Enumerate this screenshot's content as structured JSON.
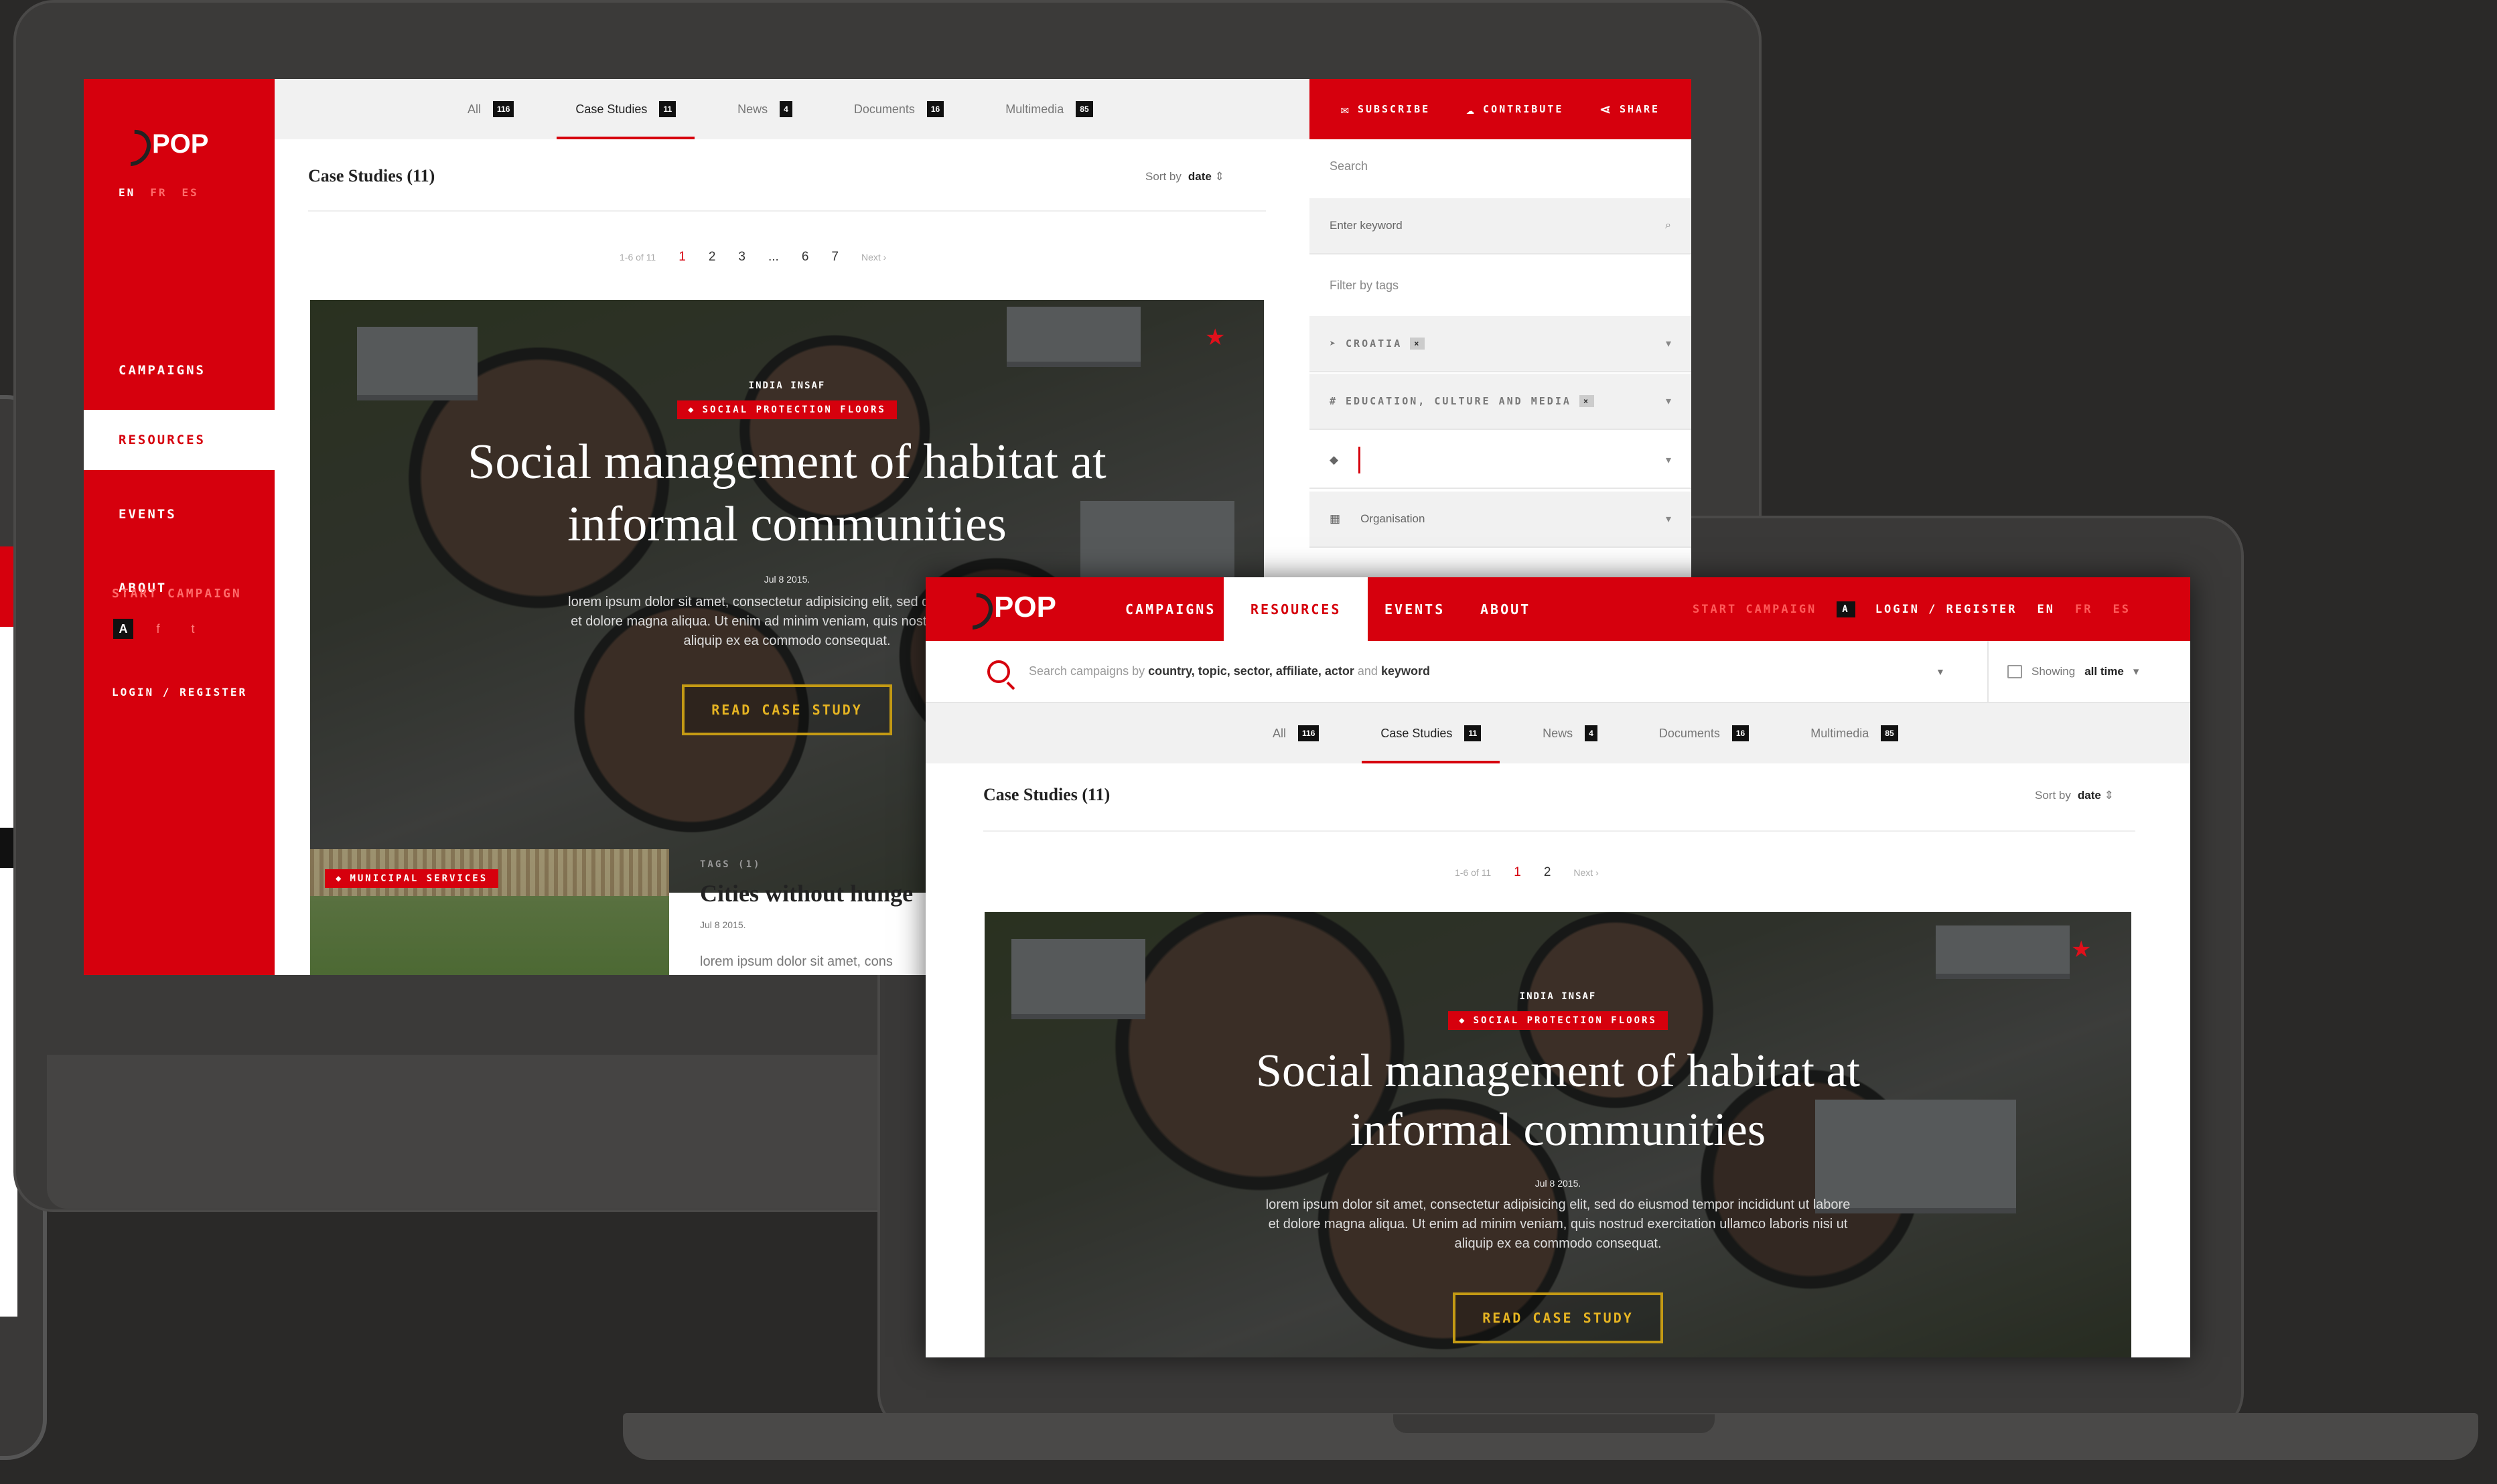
{
  "brand": {
    "name": "POP",
    "accent": "#d6000d"
  },
  "languages": [
    "EN",
    "FR",
    "ES"
  ],
  "desktop": {
    "sidebar": {
      "nav": [
        {
          "label": "CAMPAIGNS"
        },
        {
          "label": "RESOURCES",
          "active": true
        },
        {
          "label": "EVENTS"
        },
        {
          "label": "ABOUT"
        }
      ],
      "start_campaign": "START CAMPAIGN",
      "login": "LOGIN / REGISTER"
    },
    "tabs": [
      {
        "label": "All",
        "count": "116"
      },
      {
        "label": "Case Studies",
        "count": "11",
        "active": true
      },
      {
        "label": "News",
        "count": "4"
      },
      {
        "label": "Documents",
        "count": "16"
      },
      {
        "label": "Multimedia",
        "count": "85"
      }
    ],
    "section_title": "Case Studies (11)",
    "sort": {
      "label": "Sort by",
      "value": "date"
    },
    "pagination": {
      "range": "1-6 of 11",
      "pages": [
        "1",
        "2",
        "3",
        "...",
        "6",
        "7"
      ],
      "current": "1",
      "next": "Next ›"
    },
    "featured": {
      "tags": "INDIA  INSAF",
      "category": "SOCIAL PROTECTION FLOORS",
      "title_line1": "Social management of habitat at",
      "title_line2": "informal communities",
      "date": "Jul 8 2015.",
      "excerpt_line1": "lorem ipsum dolor sit amet, consectetur adipisicing elit, sed do eiusmod te",
      "excerpt_line2": "et dolore magna aliqua. Ut enim ad minim veniam, quis nostrud exercitati",
      "excerpt_line3": "aliquip ex ea commodo consequat.",
      "cta": "READ CASE STUDY"
    },
    "second_card": {
      "category": "MUNICIPAL SERVICES",
      "tags": "TAGS (1)",
      "title": "Cities without hunge",
      "date": "Jul 8 2015.",
      "excerpt": "lorem ipsum dolor sit amet, cons"
    },
    "actions": [
      {
        "label": "SUBSCRIBE",
        "icon": "envelope-icon"
      },
      {
        "label": "CONTRIBUTE",
        "icon": "cloud-upload-icon"
      },
      {
        "label": "SHARE",
        "icon": "share-icon"
      }
    ],
    "filters": {
      "search_label": "Search",
      "keyword_placeholder": "Enter keyword",
      "tags_label": "Filter by tags",
      "country_chip": "CROATIA",
      "topic_chip": "EDUCATION, CULTURE AND MEDIA",
      "organisation_placeholder": "Organisation"
    }
  },
  "laptop": {
    "nav": [
      {
        "label": "CAMPAIGNS"
      },
      {
        "label": "RESOURCES",
        "active": true
      },
      {
        "label": "EVENTS"
      },
      {
        "label": "ABOUT"
      }
    ],
    "start_campaign": "START CAMPAIGN",
    "login": "LOGIN / REGISTER",
    "search": {
      "placeholder_prefix": "Search campaigns by",
      "placeholder_terms": "country, topic, sector, affiliate, actor",
      "placeholder_and": "and",
      "placeholder_keyword": "keyword",
      "time_label": "Showing",
      "time_value": "all time"
    },
    "tabs": [
      {
        "label": "All",
        "count": "116"
      },
      {
        "label": "Case Studies",
        "count": "11",
        "active": true
      },
      {
        "label": "News",
        "count": "4"
      },
      {
        "label": "Documents",
        "count": "16"
      },
      {
        "label": "Multimedia",
        "count": "85"
      }
    ],
    "section_title": "Case Studies (11)",
    "sort": {
      "label": "Sort by",
      "value": "date"
    },
    "pagination": {
      "range": "1-6 of 11",
      "pages": [
        "1",
        "2"
      ],
      "current": "1",
      "next": "Next ›"
    },
    "featured": {
      "tags": "INDIA  INSAF",
      "category": "SOCIAL PROTECTION FLOORS",
      "title_line1": "Social management of habitat at",
      "title_line2": "informal communities",
      "date": "Jul 8 2015.",
      "excerpt_line1": "lorem ipsum dolor sit amet, consectetur adipisicing elit, sed do eiusmod tempor incididunt ut labore",
      "excerpt_line2": "et dolore magna aliqua. Ut enim ad minim veniam, quis nostrud exercitation ullamco laboris nisi ut",
      "excerpt_line3": "aliquip ex ea commodo consequat.",
      "cta": "READ CASE STUDY"
    }
  }
}
